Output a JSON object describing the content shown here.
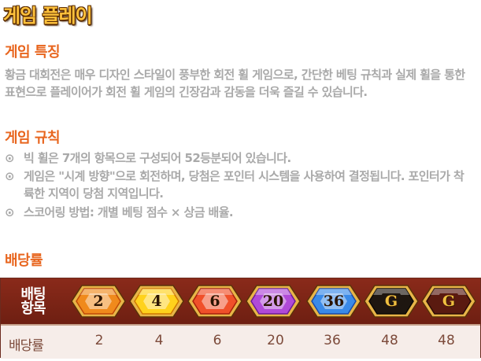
{
  "page": {
    "title": "게임 플레이"
  },
  "features": {
    "title": "게임 특징",
    "text": "황금 대회전은 매우 디자인 스타일이 풍부한 회전 휠 게임으로, 간단한 베팅 규칙과 실제 휠을 통한 표현으로 플레이어가 회전 휠 게임의 긴장감과 감동을 더욱 즐길 수 있습니다."
  },
  "rules": {
    "title": "게임 규칙",
    "bullet_symbol": "⊙",
    "items": [
      "빅 휠은 7개의 항목으로 구성되어 52등분되어 있습니다.",
      "게임은 \"시계 방향\"으로 회전하며, 당첨은 포인터 시스템을 사용하여 결정됩니다. 포인터가 착륙한 지역이 당첨 지역입니다.",
      "스코어링 방법: 개별 베팅 점수 × 상금 배율."
    ]
  },
  "payout": {
    "title": "배당률",
    "head_label": "배팅\n항목",
    "row_label": "배당률",
    "items": [
      {
        "label": "2",
        "payout": "2",
        "color": "#f08a1c",
        "edge": "#c04a08"
      },
      {
        "label": "4",
        "payout": "4",
        "color": "#ffd21c",
        "edge": "#d07a00"
      },
      {
        "label": "6",
        "payout": "6",
        "color": "#f0502a",
        "edge": "#a8200c"
      },
      {
        "label": "20",
        "payout": "20",
        "color": "#b04ad8",
        "edge": "#6a1a98"
      },
      {
        "label": "36",
        "payout": "36",
        "color": "#3a8ae8",
        "edge": "#1a4aa8"
      },
      {
        "label": "G",
        "payout": "48",
        "color": "#1e1610",
        "edge": "#0a0806"
      },
      {
        "label": "G",
        "payout": "48",
        "color": "#5a1a10",
        "edge": "#2a0a06"
      }
    ]
  }
}
